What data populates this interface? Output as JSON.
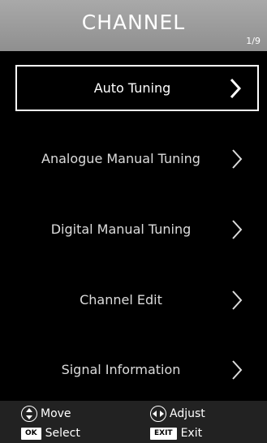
{
  "header": {
    "title": "CHANNEL",
    "page": "1/9"
  },
  "menu": {
    "items": [
      {
        "label": "Auto Tuning",
        "selected": true
      },
      {
        "label": "Analogue Manual Tuning",
        "selected": false
      },
      {
        "label": "Digital Manual Tuning",
        "selected": false
      },
      {
        "label": "Channel Edit",
        "selected": false
      },
      {
        "label": "Signal Information",
        "selected": false
      }
    ]
  },
  "footer": {
    "move": {
      "label": "Move",
      "icon": "up-down-arrows-icon"
    },
    "adjust": {
      "label": "Adjust",
      "icon": "left-right-arrows-icon"
    },
    "select": {
      "key": "OK",
      "label": "Select"
    },
    "exit": {
      "key": "EXIT",
      "label": "Exit"
    }
  },
  "colors": {
    "header_bg": "#a0a0a0",
    "background": "#000000",
    "footer_bg": "#222222",
    "text": "#ffffff"
  }
}
